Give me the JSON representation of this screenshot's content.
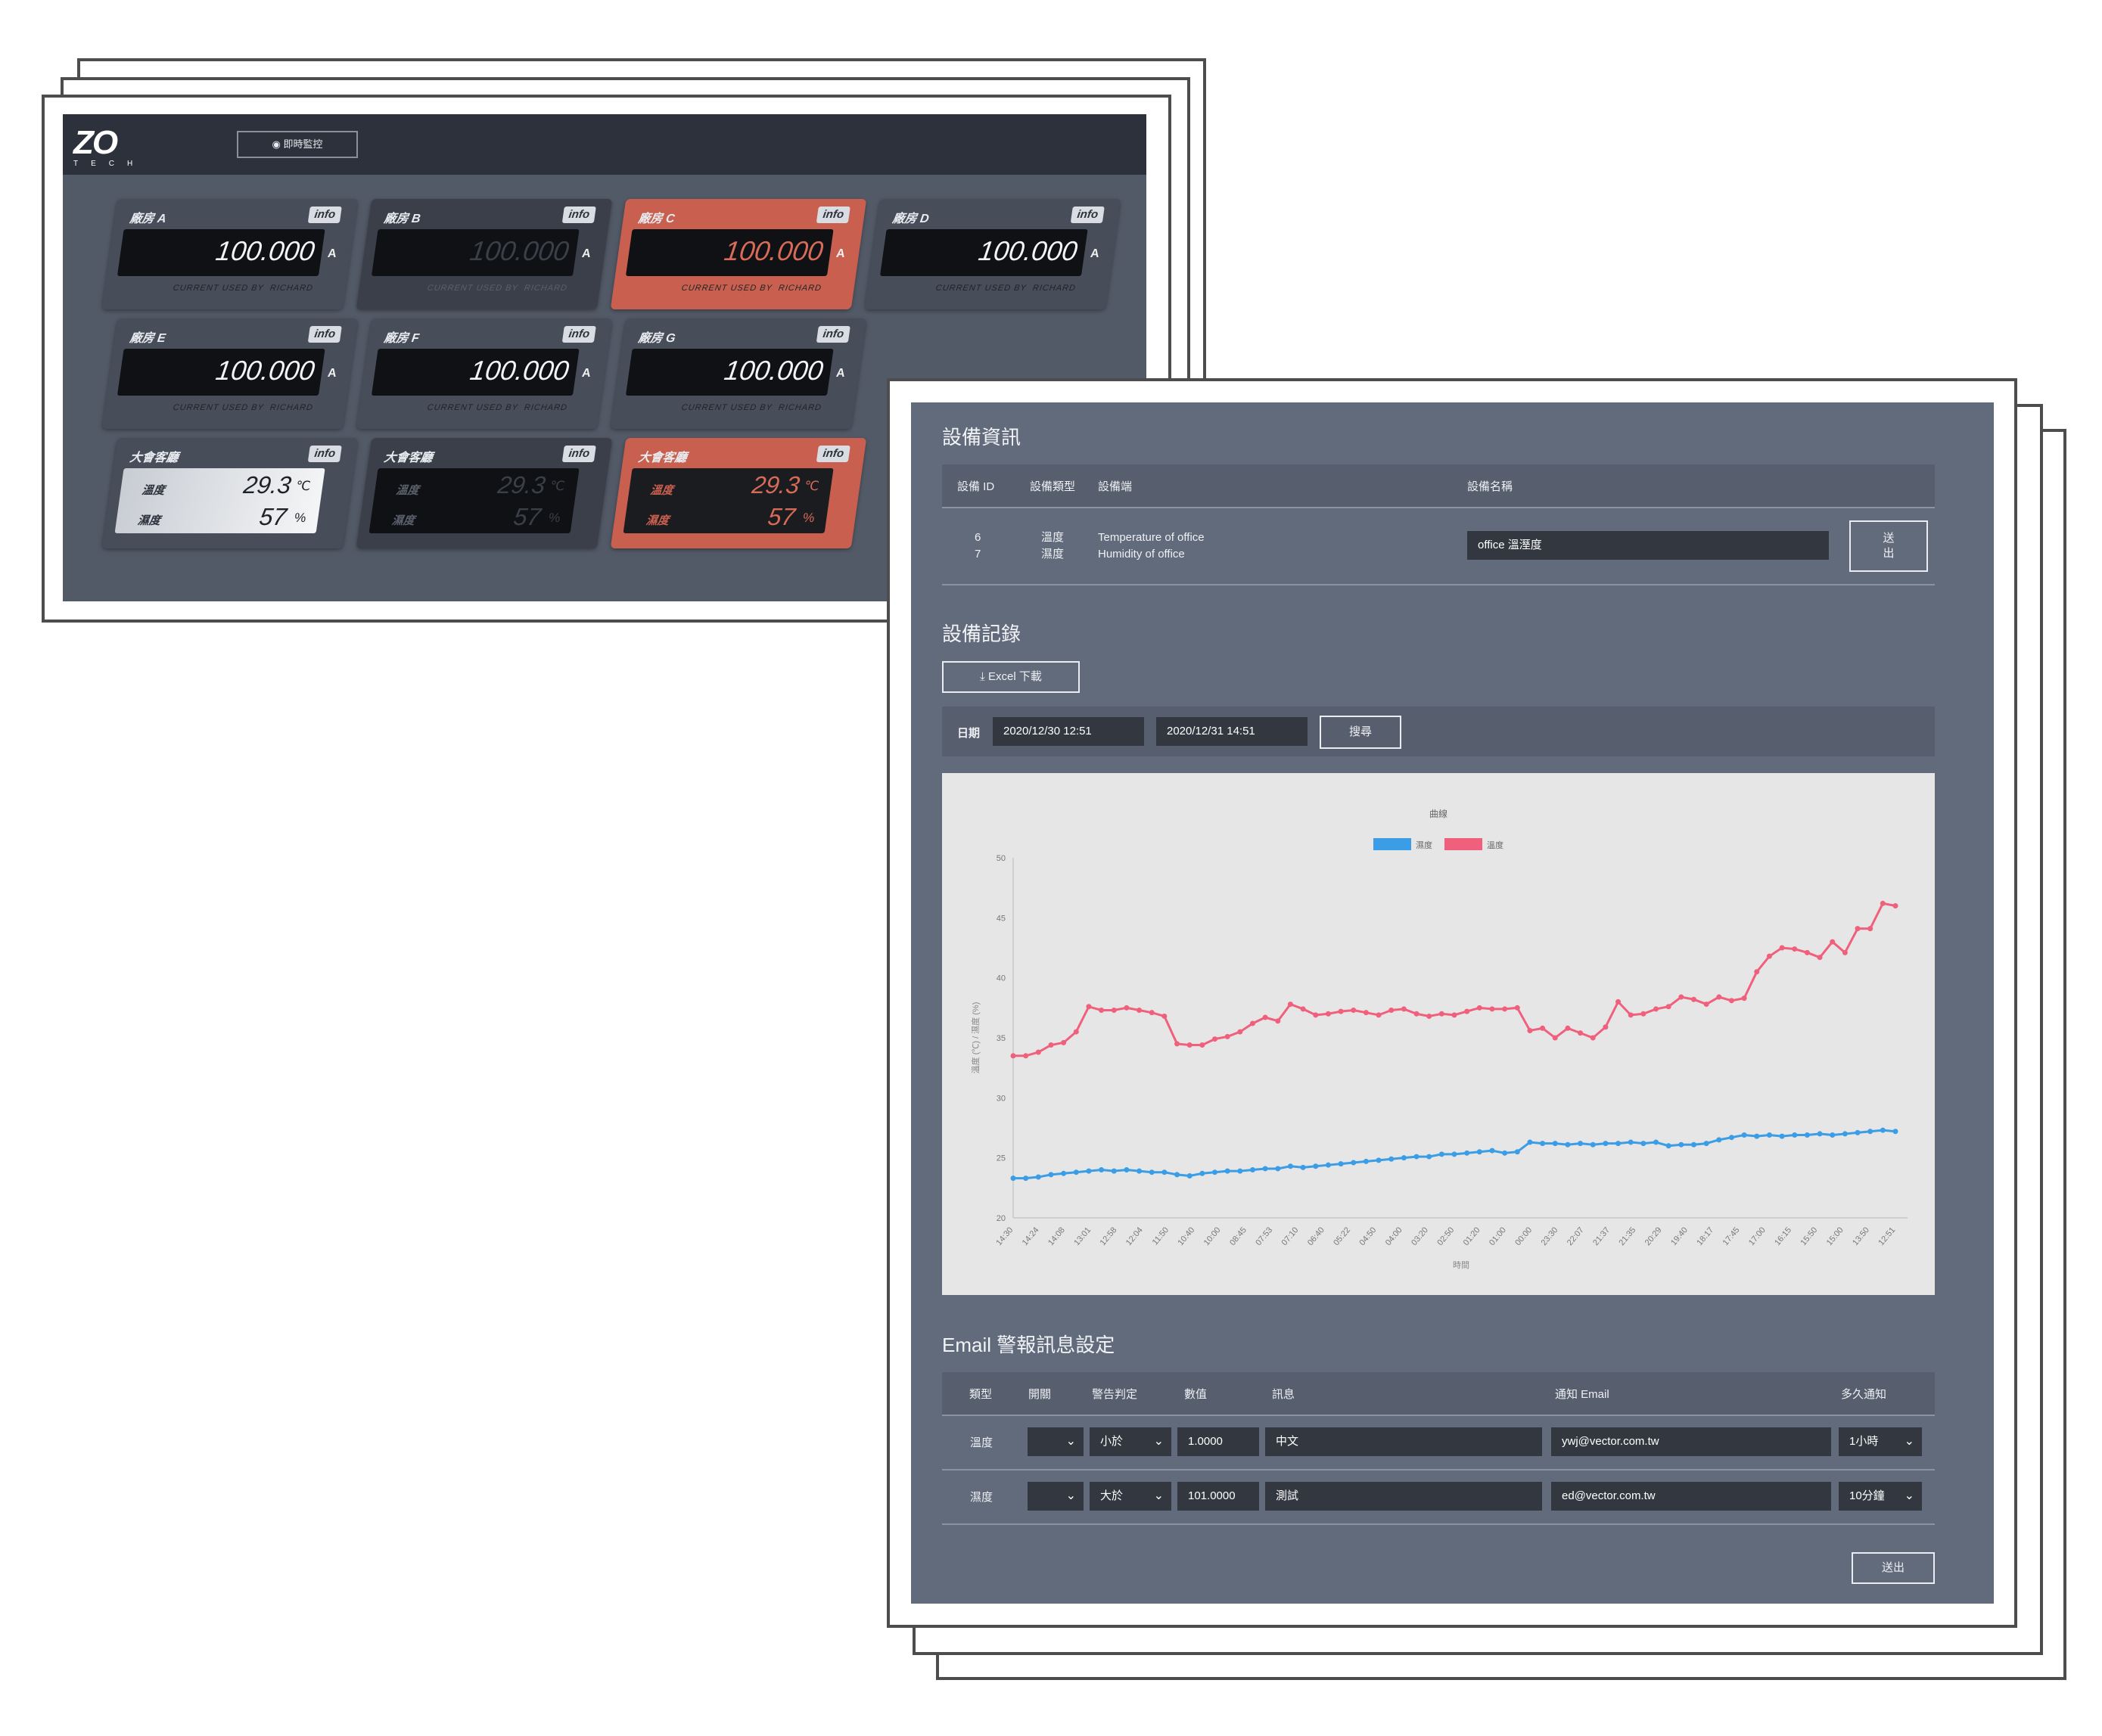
{
  "dashboard": {
    "logo_text": "ZO",
    "logo_sub": "TECH",
    "realtime_button": "即時監控",
    "info_label": "info",
    "unit_amp": "A",
    "current_used_label": "CURRENT USED BY",
    "machines": [
      {
        "name": "廠房 A",
        "value": "100.000",
        "user": "RICHARD",
        "state": "normal"
      },
      {
        "name": "廠房 B",
        "value": "100.000",
        "user": "RICHARD",
        "state": "off"
      },
      {
        "name": "廠房 C",
        "value": "100.000",
        "user": "RICHARD",
        "state": "alert"
      },
      {
        "name": "廠房 D",
        "value": "100.000",
        "user": "RICHARD",
        "state": "normal"
      },
      {
        "name": "廠房 E",
        "value": "100.000",
        "user": "RICHARD",
        "state": "normal"
      },
      {
        "name": "廠房 F",
        "value": "100.000",
        "user": "RICHARD",
        "state": "normal"
      },
      {
        "name": "廠房 G",
        "value": "100.000",
        "user": "RICHARD",
        "state": "normal"
      }
    ],
    "env_sensors": [
      {
        "name": "大會客廳",
        "temp_label": "溫度",
        "temp": "29.3",
        "temp_unit": "℃",
        "hum_label": "濕度",
        "hum": "57",
        "hum_unit": "%",
        "state": "light"
      },
      {
        "name": "大會客廳",
        "temp_label": "溫度",
        "temp": "29.3",
        "temp_unit": "℃",
        "hum_label": "濕度",
        "hum": "57",
        "hum_unit": "%",
        "state": "dark"
      },
      {
        "name": "大會客廳",
        "temp_label": "溫度",
        "temp": "29.3",
        "temp_unit": "℃",
        "hum_label": "濕度",
        "hum": "57",
        "hum_unit": "%",
        "state": "alert"
      }
    ]
  },
  "detail": {
    "device_info_title": "設備資訊",
    "device_table_headers": [
      "設備 ID",
      "設備類型",
      "設備端",
      "設備名稱"
    ],
    "device_ids": [
      "6",
      "7"
    ],
    "device_types": [
      "溫度",
      "濕度"
    ],
    "device_ends": [
      "Temperature of office",
      "Humidity of office"
    ],
    "device_name_value": "office 溫溼度",
    "device_submit": "送出",
    "records_title": "設備記錄",
    "excel_button": "Excel 下載",
    "date_label": "日期",
    "date_from": "2020/12/30 12:51",
    "date_to": "2020/12/31 14:51",
    "search_button": "搜尋",
    "email_title": "Email 警報訊息設定",
    "email_headers": [
      "類型",
      "開關",
      "警告判定",
      "數值",
      "訊息",
      "通知 Email",
      "多久通知"
    ],
    "email_rows": [
      {
        "type": "溫度",
        "switch": "",
        "judge": "小於",
        "value": "1.0000",
        "message": "中文",
        "email": "ywj@vector.com.tw",
        "interval": "1小時"
      },
      {
        "type": "濕度",
        "switch": "",
        "judge": "大於",
        "value": "101.0000",
        "message": "測試",
        "email": "ed@vector.com.tw",
        "interval": "10分鐘"
      }
    ],
    "email_submit": "送出"
  },
  "colors": {
    "temp_series": "#f0607c",
    "hum_series": "#3a9de6",
    "alert_card": "#c9604f",
    "panel": "#626b7c"
  },
  "chart_data": {
    "type": "line",
    "title": "曲線",
    "xlabel": "時間",
    "ylabel": "溫度 (℃) / 濕度 (%)",
    "ylim": [
      20,
      50
    ],
    "yticks": [
      20,
      25,
      30,
      35,
      40,
      45,
      50
    ],
    "x_tick_labels": [
      "14:30",
      "14:24",
      "14:08",
      "13:01",
      "12:58",
      "12:04",
      "11:50",
      "10:40",
      "10:00",
      "08:45",
      "07:53",
      "07:10",
      "06:40",
      "05:22",
      "04:50",
      "04:00",
      "03:20",
      "02:50",
      "01:20",
      "01:00",
      "00:00",
      "23:30",
      "22:07",
      "21:37",
      "21:35",
      "20:29",
      "19:40",
      "18:17",
      "17:45",
      "17:00",
      "16:15",
      "15:50",
      "15:00",
      "13:50",
      "12:51"
    ],
    "legend": [
      "濕度",
      "溫度"
    ],
    "series": [
      {
        "name": "溫度",
        "color": "#f0607c",
        "values": [
          33.5,
          33.5,
          33.8,
          34.4,
          34.6,
          35.5,
          37.6,
          37.3,
          37.3,
          37.5,
          37.3,
          37.1,
          36.8,
          34.5,
          34.4,
          34.4,
          34.9,
          35.1,
          35.5,
          36.2,
          36.7,
          36.4,
          37.8,
          37.4,
          36.9,
          37.0,
          37.2,
          37.3,
          37.1,
          36.9,
          37.3,
          37.4,
          37.0,
          36.8,
          37.0,
          36.9,
          37.2,
          37.5,
          37.4,
          37.4,
          37.5,
          35.6,
          35.8,
          35.0,
          35.8,
          35.4,
          35.0,
          35.9,
          38.0,
          36.9,
          37.0,
          37.4,
          37.6,
          38.4,
          38.2,
          37.8,
          38.4,
          38.1,
          38.3,
          40.5,
          41.8,
          42.5,
          42.4,
          42.1,
          41.7,
          43.0,
          42.1,
          44.1,
          44.1,
          46.2,
          46.0
        ]
      },
      {
        "name": "濕度",
        "color": "#3a9de6",
        "values": [
          23.3,
          23.3,
          23.4,
          23.6,
          23.7,
          23.8,
          23.9,
          24.0,
          23.9,
          24.0,
          23.9,
          23.8,
          23.8,
          23.6,
          23.5,
          23.7,
          23.8,
          23.9,
          23.9,
          24.0,
          24.1,
          24.1,
          24.3,
          24.2,
          24.3,
          24.4,
          24.5,
          24.6,
          24.7,
          24.8,
          24.9,
          25.0,
          25.1,
          25.1,
          25.3,
          25.3,
          25.4,
          25.5,
          25.6,
          25.4,
          25.5,
          26.3,
          26.2,
          26.2,
          26.1,
          26.2,
          26.1,
          26.2,
          26.2,
          26.3,
          26.2,
          26.3,
          26.0,
          26.1,
          26.1,
          26.2,
          26.5,
          26.7,
          26.9,
          26.8,
          26.9,
          26.8,
          26.9,
          26.9,
          27.0,
          26.9,
          27.0,
          27.1,
          27.2,
          27.3,
          27.2
        ]
      }
    ]
  }
}
